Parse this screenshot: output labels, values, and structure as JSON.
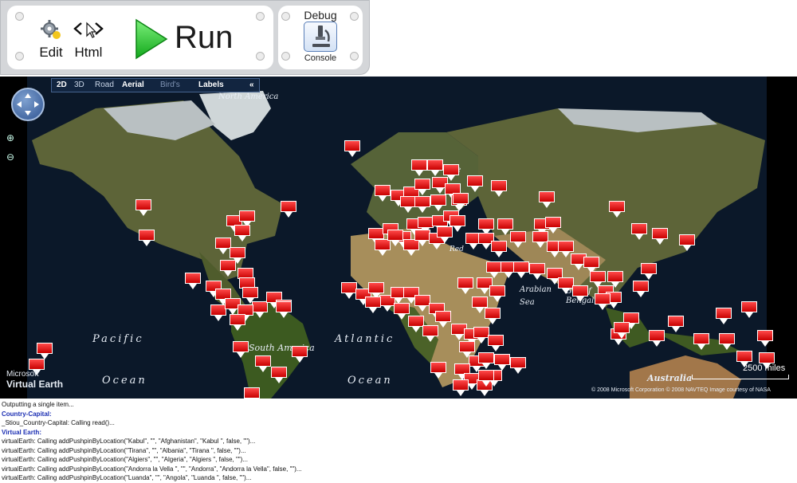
{
  "toolbar": {
    "edit_label": "Edit",
    "html_label": "Html",
    "run_label": "Run",
    "debug_title": "Debug",
    "console_label": "Console"
  },
  "map": {
    "mode_2d": "2D",
    "mode_3d": "3D",
    "style_road": "Road",
    "style_aerial": "Aerial",
    "style_birds": "Bird's",
    "labels": "Labels",
    "collapse": "«",
    "labels_geo": {
      "north_america": "North America",
      "south_america": "South America",
      "pacific": "Pacific",
      "ocean_left": "Ocean",
      "atlantic": "Atlantic",
      "ocean_right": "Ocean",
      "europe_fragment": "pe",
      "arabian_sea": "Arabian\nSea",
      "bay_of_bengal": "Bay of\nBengal",
      "australia": "Australia",
      "red": "Red"
    },
    "scale": "2500 miles",
    "brand_small": "Microsoft",
    "brand_big": "Virtual Earth",
    "copyright": "© 2008 Microsoft Corporation    © 2008 NAVTEQ    Image courtesy of NASA"
  },
  "console_lines": [
    {
      "text": "Outputting a single item...",
      "head": false
    },
    {
      "text": "Country-Capital:",
      "head": true
    },
    {
      "text": "_Stiou_Country-Capital: Calling read()...",
      "head": false
    },
    {
      "text": "Virtual Earth:",
      "head": true
    },
    {
      "text": "virtualEarth: Calling addPushpinByLocation(\"Kabul\", \"\", \"Afghanistan\", \"Kabul \", false, \"\")...",
      "head": false
    },
    {
      "text": "virtualEarth: Calling addPushpinByLocation(\"Tirana\", \"\", \"Albania\", \"Tirana \", false, \"\")...",
      "head": false
    },
    {
      "text": "virtualEarth: Calling addPushpinByLocation(\"Algiers\", \"\", \"Algeria\", \"Algiers \", false, \"\")...",
      "head": false
    },
    {
      "text": "virtualEarth: Calling addPushpinByLocation(\"Andorra la Vella \", \"\", \"Andorra\", \"Andorra la Vella\", false, \"\")...",
      "head": false
    },
    {
      "text": "virtualEarth: Calling addPushpinByLocation(\"Luanda\", \"\", \"Angola\", \"Luanda \", false, \"\")...",
      "head": false
    }
  ]
}
